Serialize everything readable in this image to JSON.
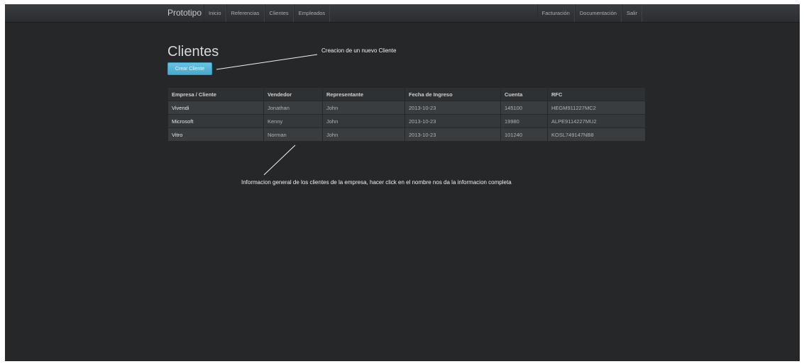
{
  "navbar": {
    "brand": "Prototipo",
    "left_items": [
      {
        "label": "Inicio"
      },
      {
        "label": "Referencias"
      },
      {
        "label": "Clientes"
      },
      {
        "label": "Empleados"
      }
    ],
    "right_items": [
      {
        "label": "Facturación"
      },
      {
        "label": "Documentación"
      },
      {
        "label": "Salir"
      }
    ]
  },
  "page": {
    "title": "Clientes",
    "create_button_label": "Crear Cliente"
  },
  "annotations": {
    "create": "Creacion de un nuevo Cliente",
    "info": "Informacion general de los clientes de la empresa, hacer click en el nombre nos da la informacion completa"
  },
  "table": {
    "headers": [
      "Empresa / Cliente",
      "Vendedor",
      "Representante",
      "Fecha de Ingreso",
      "Cuenta",
      "RFC"
    ],
    "rows": [
      [
        "Vivendi",
        "Jonathan",
        "John",
        "2013-10-23",
        "145100",
        "HEGM911227MC2"
      ],
      [
        "Microsoft",
        "Kenny",
        "John",
        "2013-10-23",
        "19980",
        "ALPE9114227MU2"
      ],
      [
        "Vitro",
        "Norman",
        "John",
        "2013-10-23",
        "101240",
        "KOSL749147NB8"
      ]
    ]
  },
  "colors": {
    "background": "#252729",
    "navbar": "#2f3134",
    "button": "#5bb8dc",
    "annotation_text": "#f2f2f2"
  }
}
